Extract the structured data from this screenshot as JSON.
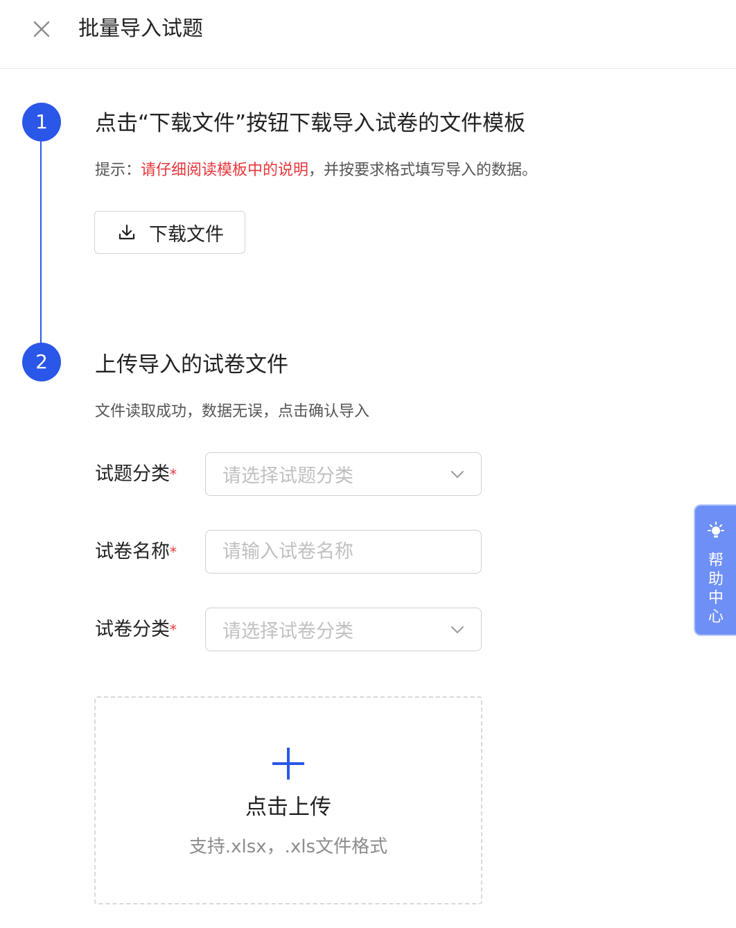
{
  "header": {
    "title": "批量导入试题",
    "close_icon": "close-icon"
  },
  "steps": [
    {
      "number": "1",
      "title": "点击“下载文件”按钮下载导入试卷的文件模板",
      "hint_prefix": "提示：",
      "hint_highlight": "请仔细阅读模板中的说明",
      "hint_suffix": "，并按要求格式填写导入的数据。",
      "download_button": {
        "label": "下载文件",
        "icon": "download-icon"
      }
    },
    {
      "number": "2",
      "title": "上传导入的试卷文件",
      "status": "文件读取成功，数据无误，点击确认导入"
    }
  ],
  "form": {
    "question_category": {
      "label": "试题分类",
      "required": "*",
      "placeholder": "请选择试题分类"
    },
    "paper_name": {
      "label": "试卷名称",
      "required": "*",
      "placeholder": "请输入试卷名称"
    },
    "paper_category": {
      "label": "试卷分类",
      "required": "*",
      "placeholder": "请选择试卷分类"
    }
  },
  "upload": {
    "title": "点击上传",
    "subtitle": "支持.xlsx，.xls文件格式",
    "icon": "plus-icon"
  },
  "help": {
    "label": "帮助中心",
    "icon": "lightbulb-icon"
  },
  "colors": {
    "accent": "#2a57e8",
    "required": "#e8363b",
    "help_tab": "#6e8ff5"
  }
}
